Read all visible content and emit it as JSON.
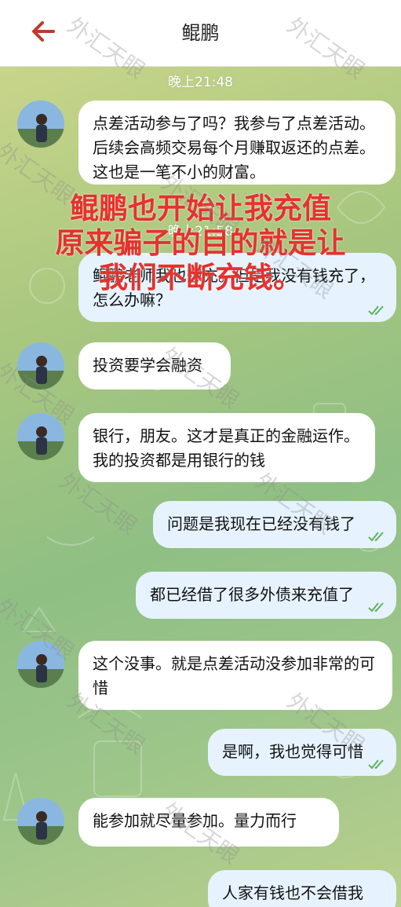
{
  "header": {
    "title": "鲲鹏",
    "back_icon": "arrow-left-icon"
  },
  "colors": {
    "accent_red": "#c0392b",
    "outgoing_bubble": "#e6f3ff",
    "incoming_bubble": "#ffffff",
    "overlay_text": "#e5322e"
  },
  "messages": {
    "time1": "晚上21:48",
    "m1": "点差活动参与了吗？我参与了点差活动。后续会高频交易每个月赚取返还的点差。这也是一笔不小的财富。",
    "time2": "晚上21:58",
    "m2": "鲲鹏老师我也想充。但是我没有钱充了，怎么办嘛？",
    "m3": "投资要学会融资",
    "m4": "银行，朋友。这才是真正的金融运作。我的投资都是用银行的钱",
    "m5": "问题是我现在已经没有钱了",
    "m6": "都已经借了很多外债来充值了",
    "m7": "这个没事。就是点差活动没参加非常的可惜",
    "m8": "是啊，我也觉得可惜",
    "m9": "能参加就尽量参加。量力而行",
    "m10": "人家有钱也不会借我"
  },
  "overlay": {
    "line1": "鲲鹏也开始让我充值",
    "line2": "原来骗子的目的就是让",
    "line3": "我们不断充钱。"
  },
  "watermark": "外汇天眼"
}
